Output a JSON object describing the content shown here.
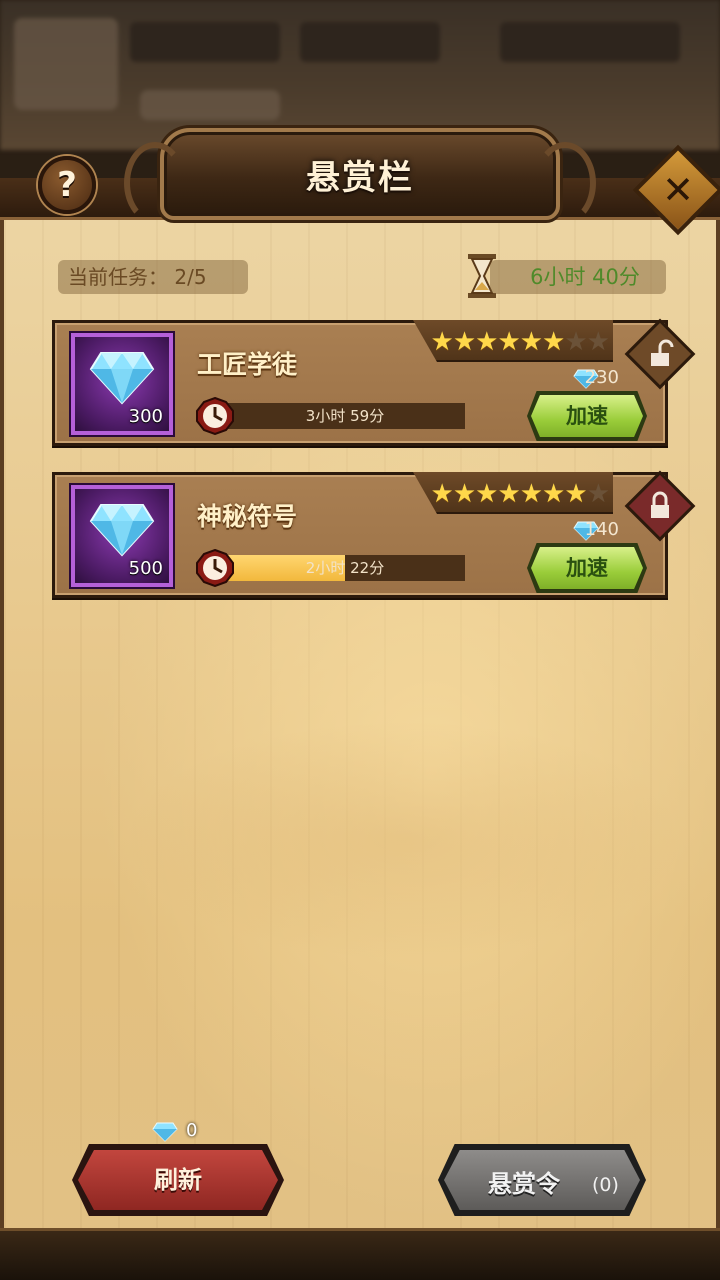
{
  "header": {
    "title": "悬赏栏",
    "help_label": "?",
    "close_label": "✕"
  },
  "status": {
    "task_count": "当前任务：  2/5",
    "time_remaining": "6小时 40分"
  },
  "tasks": [
    {
      "name": "工匠学徒",
      "reward_amount": "300",
      "stars_filled": 6,
      "stars_total": 8,
      "stars_on": "★★★★★★",
      "stars_off": "★★",
      "progress_text": "3小时 59分",
      "progress": 0,
      "speedup_cost": "230",
      "speedup_label": "加速",
      "lock_state": "unlocked",
      "lock_color": "#6e4a28"
    },
    {
      "name": "神秘符号",
      "reward_amount": "500",
      "stars_filled": 7,
      "stars_total": 8,
      "stars_on": "★★★★★★★",
      "stars_off": "★",
      "progress_text": "2小时 22分",
      "progress": 0.5,
      "speedup_cost": "140",
      "speedup_label": "加速",
      "lock_state": "locked",
      "lock_color": "#7a2a2a"
    }
  ],
  "footer": {
    "refresh_label": "刷新",
    "refresh_cost": "0",
    "bounty_label": "悬赏令",
    "bounty_count": "(0)"
  },
  "icons": {
    "gem": "diamond-icon",
    "clock": "clock-icon",
    "hourglass": "hourglass-icon",
    "lock_open": "lock-open-icon",
    "lock_closed": "lock-closed-icon"
  },
  "colors": {
    "progress_fill": "#f2b83c",
    "speed_button": "#9acd3a",
    "refresh_button": "#b03a33",
    "bounty_button": "#6f6d6b",
    "timer_text": "#4f8a2a"
  }
}
